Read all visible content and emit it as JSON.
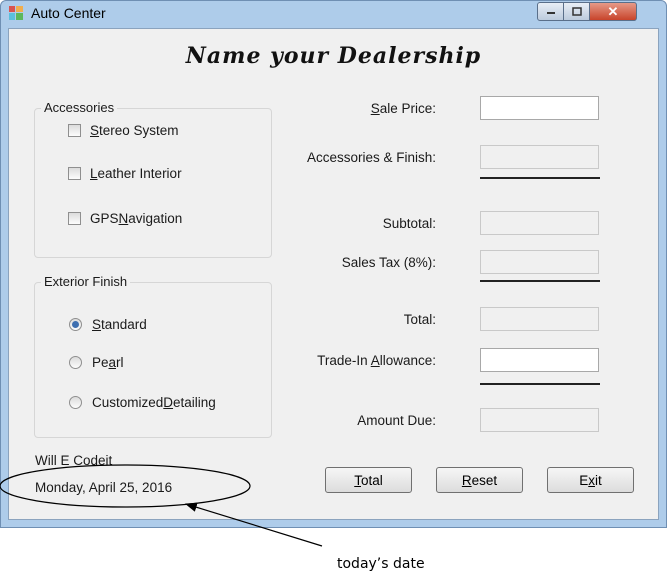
{
  "window": {
    "title": "Auto Center"
  },
  "heading": "Name your Dealership",
  "accessories": {
    "label": "Accessories",
    "items": [
      {
        "pre": "",
        "key": "S",
        "post": "tereo System",
        "checked": false
      },
      {
        "pre": "",
        "key": "L",
        "post": "eather Interior",
        "checked": false
      },
      {
        "pre": "GPS ",
        "key": "N",
        "post": "avigation",
        "checked": false
      }
    ]
  },
  "exterior": {
    "label": "Exterior Finish",
    "items": [
      {
        "pre": "",
        "key": "S",
        "post": "tandard",
        "checked": true
      },
      {
        "pre": "Pe",
        "key": "a",
        "post": "rl",
        "checked": false
      },
      {
        "pre": "Customized ",
        "key": "D",
        "post": "etailing",
        "checked": false
      }
    ]
  },
  "fields": {
    "sale_price": {
      "pre": "",
      "key": "S",
      "post": "ale Price:",
      "value": ""
    },
    "accessories_finish": {
      "label": "Accessories & Finish:",
      "value": ""
    },
    "subtotal": {
      "label": "Subtotal:",
      "value": ""
    },
    "sales_tax": {
      "label": "Sales Tax (8%):",
      "value": ""
    },
    "total": {
      "label": "Total:",
      "value": ""
    },
    "trade_in": {
      "pre": "Trade-In ",
      "key": "A",
      "post": "llowance:",
      "value": ""
    },
    "amount_due": {
      "label": "Amount Due:",
      "value": ""
    }
  },
  "buttons": {
    "total": {
      "pre": "",
      "key": "T",
      "post": "otal"
    },
    "reset": {
      "pre": "",
      "key": "R",
      "post": "eset"
    },
    "exit": {
      "pre": "E",
      "key": "x",
      "post": "it"
    }
  },
  "footer": {
    "name": "Will E Codeit",
    "date": "Monday, April 25, 2016"
  },
  "annotation": "today’s date",
  "colors": {
    "titlebar": "#aeccea",
    "close_button": "#c8442b",
    "radio_dot": "#3e6fb0"
  }
}
